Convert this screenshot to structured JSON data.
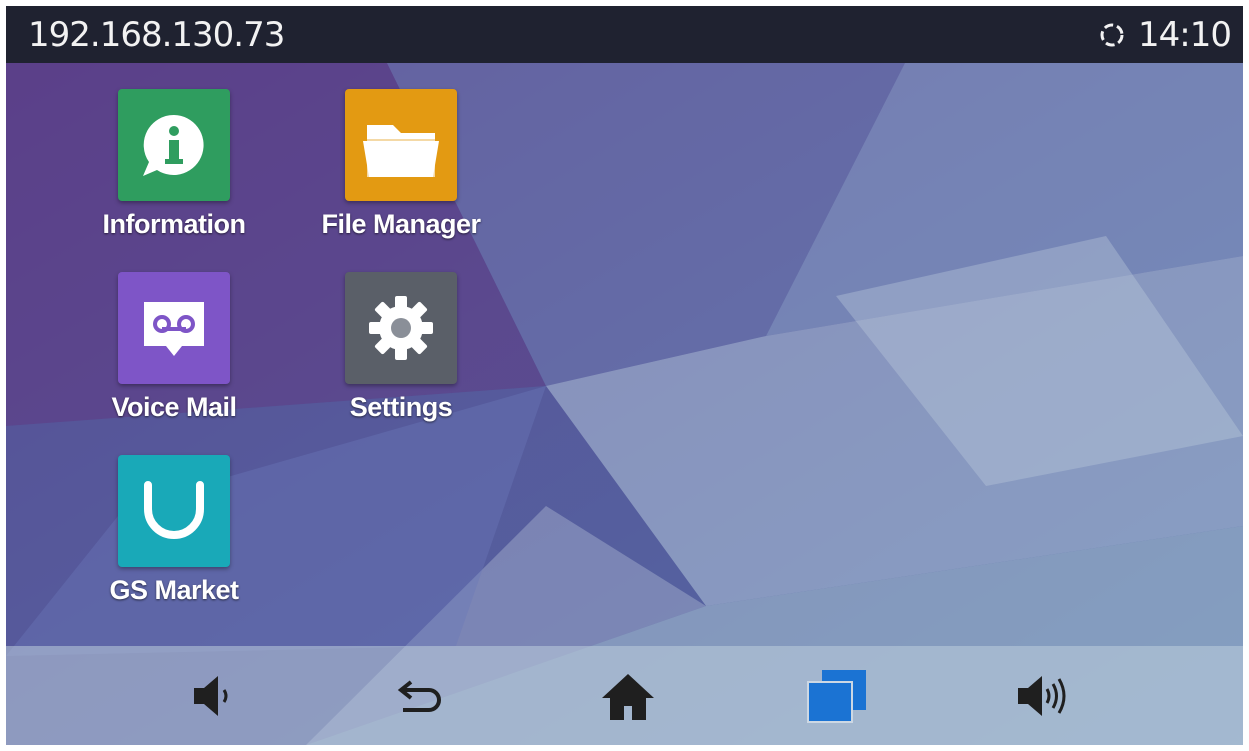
{
  "status_bar": {
    "ip_address": "192.168.130.73",
    "time": "14:10",
    "sync_icon": "sync-icon"
  },
  "apps": [
    {
      "label": "Information",
      "icon": "info-icon",
      "color": "#2f9d5f"
    },
    {
      "label": "File Manager",
      "icon": "folder-icon",
      "color": "#e39a12"
    },
    {
      "label": "Voice Mail",
      "icon": "voicemail-icon",
      "color": "#7e55c7"
    },
    {
      "label": "Settings",
      "icon": "gear-icon",
      "color": "#5a5f68"
    },
    {
      "label": "GS Market",
      "icon": "gs-market-icon",
      "color": "#19a9b8"
    }
  ],
  "nav_bar": {
    "buttons": [
      {
        "name": "volume-down",
        "icon": "volume-down-icon"
      },
      {
        "name": "back",
        "icon": "back-icon"
      },
      {
        "name": "home",
        "icon": "home-icon"
      },
      {
        "name": "recent-apps",
        "icon": "recent-apps-icon",
        "color": "#1b73d3"
      },
      {
        "name": "volume-up",
        "icon": "volume-up-icon"
      }
    ]
  }
}
